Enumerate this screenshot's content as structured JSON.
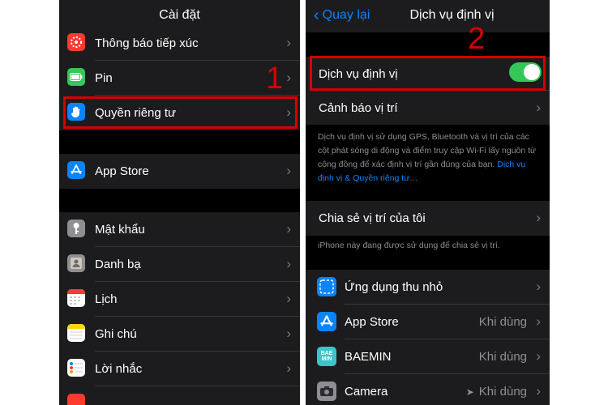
{
  "left": {
    "title": "Cài đặt",
    "group1": [
      {
        "label": "Thông báo tiếp xúc",
        "icon": "exposure-notification-icon",
        "color": "#ff3b30"
      },
      {
        "label": "Pin",
        "icon": "battery-icon",
        "color": "#34c759"
      },
      {
        "label": "Quyền riêng tư",
        "icon": "privacy-hand-icon",
        "color": "#0a84ff"
      }
    ],
    "group2": [
      {
        "label": "App Store",
        "icon": "app-store-icon",
        "color": "#0a84ff"
      }
    ],
    "group3": [
      {
        "label": "Mật khẩu",
        "icon": "key-icon",
        "color": "#8e8e93"
      },
      {
        "label": "Danh bạ",
        "icon": "contacts-icon",
        "color": "#8e8e93"
      },
      {
        "label": "Lịch",
        "icon": "calendar-icon",
        "color": "#ffffff"
      },
      {
        "label": "Ghi chú",
        "icon": "notes-icon",
        "color": "#ffd60a"
      },
      {
        "label": "Lời nhắc",
        "icon": "reminders-icon",
        "color": "#ffffff"
      }
    ]
  },
  "right": {
    "back_label": "Quay lại",
    "title": "Dịch vụ định vị",
    "location_services_label": "Dịch vụ định vị",
    "location_services_on": true,
    "location_alerts_label": "Cảnh báo vị trí",
    "description": "Dịch vụ định vị sử dụng GPS, Bluetooth và vị trí của các cột phát sóng di động và điểm truy cập Wi-Fi lấy nguồn từ cộng đồng để xác định vị trí gần đúng của bạn. ",
    "description_link": "Dịch vụ định vị & Quyền riêng tư…",
    "share_label": "Chia sẻ vị trí của tôi",
    "share_footnote": "iPhone này đang được sử dụng để chia sẻ vị trí.",
    "apps": [
      {
        "label": "Ứng dụng thu nhỏ",
        "detail": "",
        "icon": "app-clips-icon",
        "color": "#0a84ff"
      },
      {
        "label": "App Store",
        "detail": "Khi dùng",
        "icon": "app-store-icon",
        "color": "#0a84ff"
      },
      {
        "label": "BAEMIN",
        "detail": "Khi dùng",
        "icon": "baemin-icon",
        "icon_text": "BAE MIN",
        "color": "#3ac5c9"
      },
      {
        "label": "Camera",
        "detail": "Khi dùng",
        "icon": "camera-icon",
        "color": "#8e8e93"
      }
    ]
  },
  "annotations": {
    "step1": "1",
    "step2": "2",
    "highlight_color": "#d60000"
  }
}
